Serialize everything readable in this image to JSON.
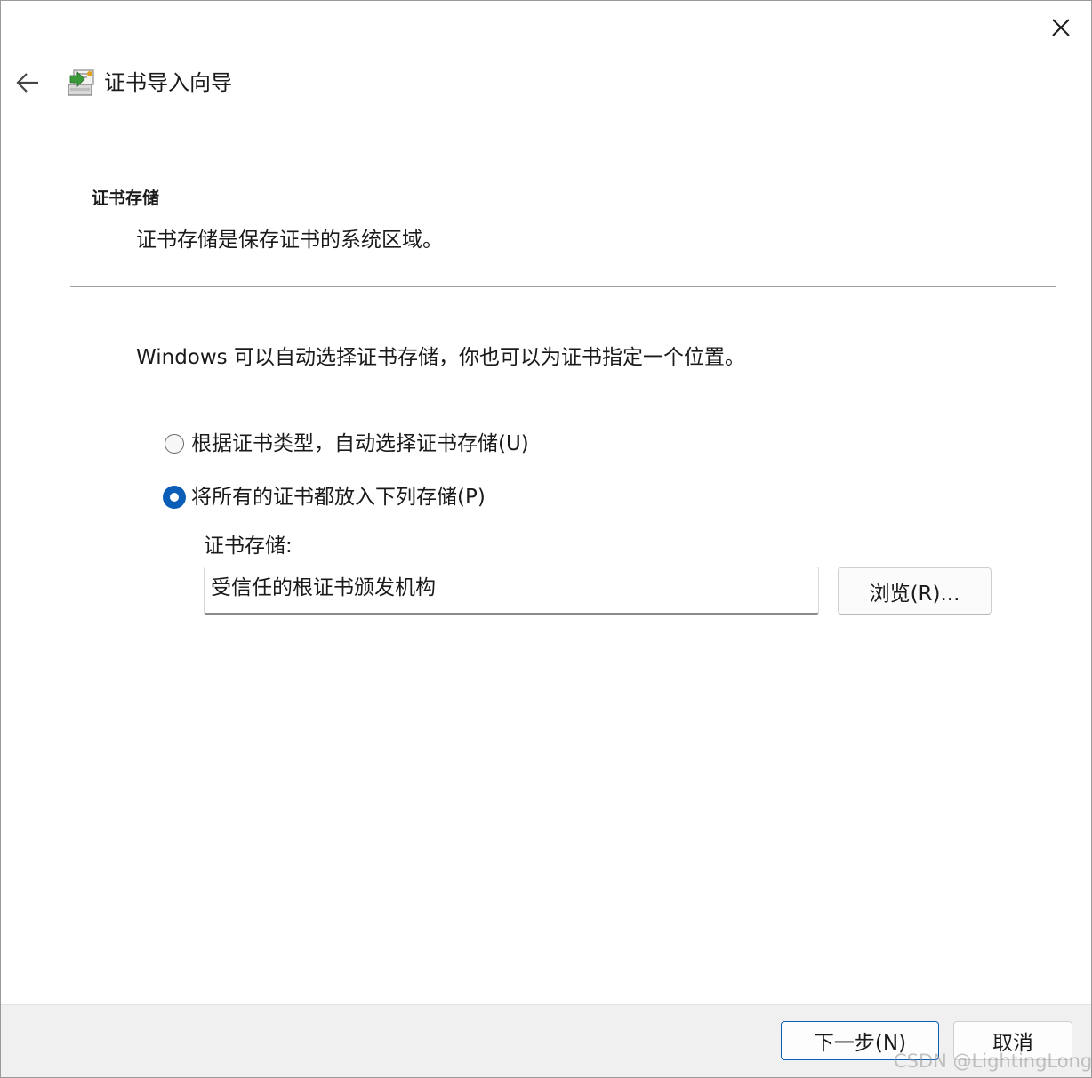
{
  "window": {
    "title": "证书导入向导"
  },
  "icons": {
    "back": "back-arrow-icon",
    "close": "close-icon",
    "title": "certificate-icon"
  },
  "section": {
    "heading": "证书存储",
    "description": "证书存储是保存证书的系统区域。"
  },
  "intro": "Windows 可以自动选择证书存储，你也可以为证书指定一个位置。",
  "options": {
    "auto": {
      "label": "根据证书类型，自动选择证书存储(U)",
      "checked": false
    },
    "manual": {
      "label": "将所有的证书都放入下列存储(P)",
      "checked": true
    }
  },
  "store": {
    "label": "证书存储:",
    "value": "受信任的根证书颁发机构",
    "browse_label": "浏览(R)..."
  },
  "footer": {
    "next_label": "下一步(N)",
    "cancel_label": "取消"
  },
  "watermark": "CSDN @LightingLong",
  "colors": {
    "accent": "#0a5eb8",
    "footer_bg": "#f0f0f0"
  }
}
